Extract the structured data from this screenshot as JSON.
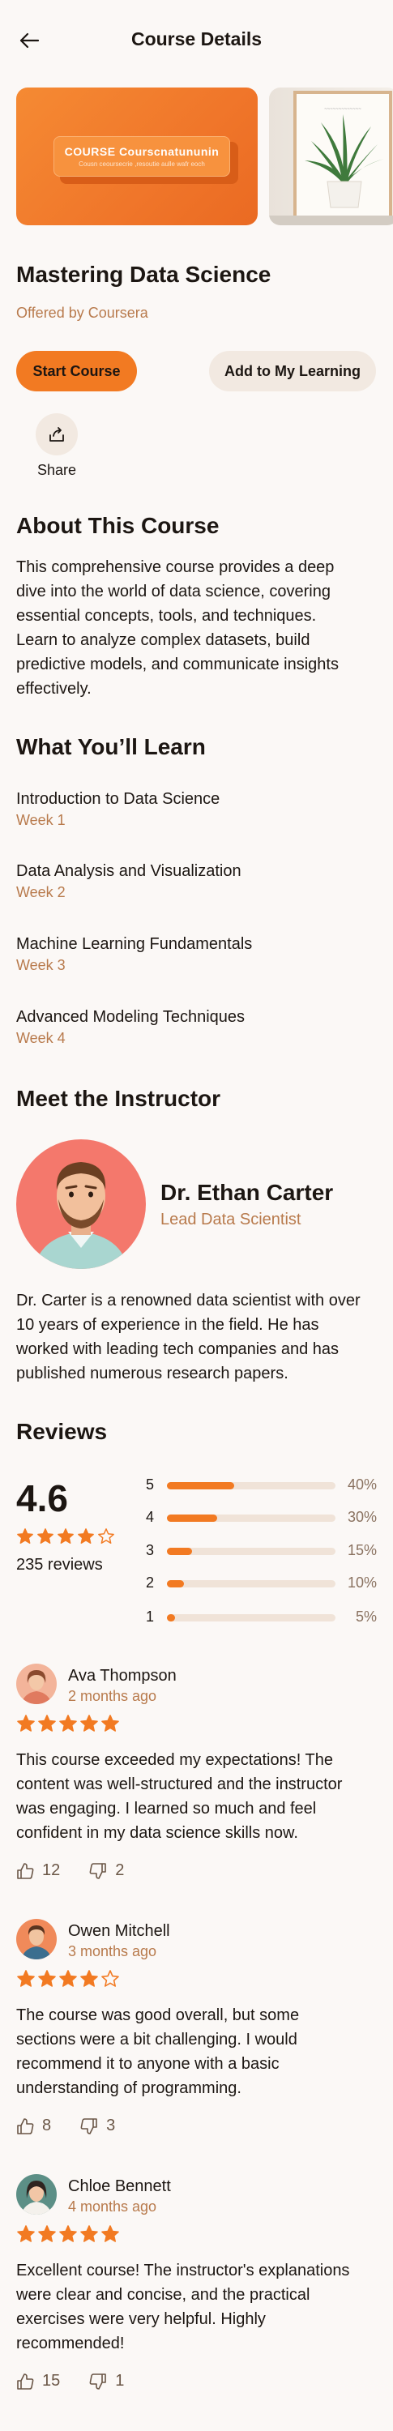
{
  "header": {
    "title": "Course Details",
    "back_icon": "arrow-left-icon"
  },
  "carousel": {
    "slides": [
      {
        "banner_title": "COURSE Courscnatununin",
        "banner_subtitle": "Cousn ceoursecrie ,resoutie aulle wafr eoch"
      },
      {
        "frame_text": "~~~~~~~~~~~~~"
      }
    ]
  },
  "course": {
    "title": "Mastering Data Science",
    "provider": "Offered by Coursera",
    "start_label": "Start Course",
    "add_label": "Add to My Learning",
    "share_label": "Share"
  },
  "about": {
    "title": "About This Course",
    "lines": [
      "This comprehensive course provides a deep",
      "dive into the world of data science, covering",
      "essential concepts, tools, and techniques.",
      "Learn to analyze complex datasets, build",
      "predictive models, and communicate insights",
      "effectively."
    ]
  },
  "learn": {
    "title": "What You’ll Learn",
    "items": [
      {
        "title": "Introduction to Data Science",
        "week": "Week 1"
      },
      {
        "title": "Data Analysis and Visualization",
        "week": "Week 2"
      },
      {
        "title": "Machine Learning Fundamentals",
        "week": "Week 3"
      },
      {
        "title": "Advanced Modeling Techniques",
        "week": "Week 4"
      }
    ]
  },
  "instructor": {
    "title": "Meet the Instructor",
    "name": "Dr. Ethan Carter",
    "role": "Lead Data Scientist",
    "bio_lines": [
      "Dr. Carter is a renowned data scientist with over",
      "10 years of experience in the field. He has",
      "worked with leading tech companies and has",
      "published numerous research papers."
    ]
  },
  "reviews": {
    "title": "Reviews",
    "rating": "4.6",
    "rating_stars": 4,
    "count_label": "235 reviews",
    "distribution": [
      {
        "star": "5",
        "pct_label": "40%",
        "pct": 40
      },
      {
        "star": "4",
        "pct_label": "30%",
        "pct": 30
      },
      {
        "star": "3",
        "pct_label": "15%",
        "pct": 15
      },
      {
        "star": "2",
        "pct_label": "10%",
        "pct": 10
      },
      {
        "star": "1",
        "pct_label": "5%",
        "pct": 5
      }
    ],
    "items": [
      {
        "name": "Ava Thompson",
        "date": "2 months ago",
        "stars": 5,
        "text_lines": [
          "This course exceeded my expectations! The",
          "content was well-structured and the instructor",
          "was engaging. I learned so much and feel",
          "confident in my data science skills now."
        ],
        "likes": "12",
        "dislikes": "2",
        "avatar_bg": "#f3b49a"
      },
      {
        "name": "Owen Mitchell",
        "date": "3 months ago",
        "stars": 4,
        "text_lines": [
          "The course was good overall, but some",
          "sections were a bit challenging. I would",
          "recommend it to anyone with a basic",
          "understanding of programming."
        ],
        "likes": "8",
        "dislikes": "3",
        "avatar_bg": "#f08a5a"
      },
      {
        "name": "Chloe Bennett",
        "date": "4 months ago",
        "stars": 5,
        "text_lines": [
          "Excellent course! The instructor's explanations",
          "were clear and concise, and the practical",
          "exercises were very helpful. Highly",
          "recommended!"
        ],
        "likes": "15",
        "dislikes": "1",
        "avatar_bg": "#5c8f86"
      }
    ]
  },
  "colors": {
    "accent": "#f27a22",
    "muted": "#b87a4c",
    "chip": "#f2e9e1",
    "background": "#fbf8f6"
  }
}
